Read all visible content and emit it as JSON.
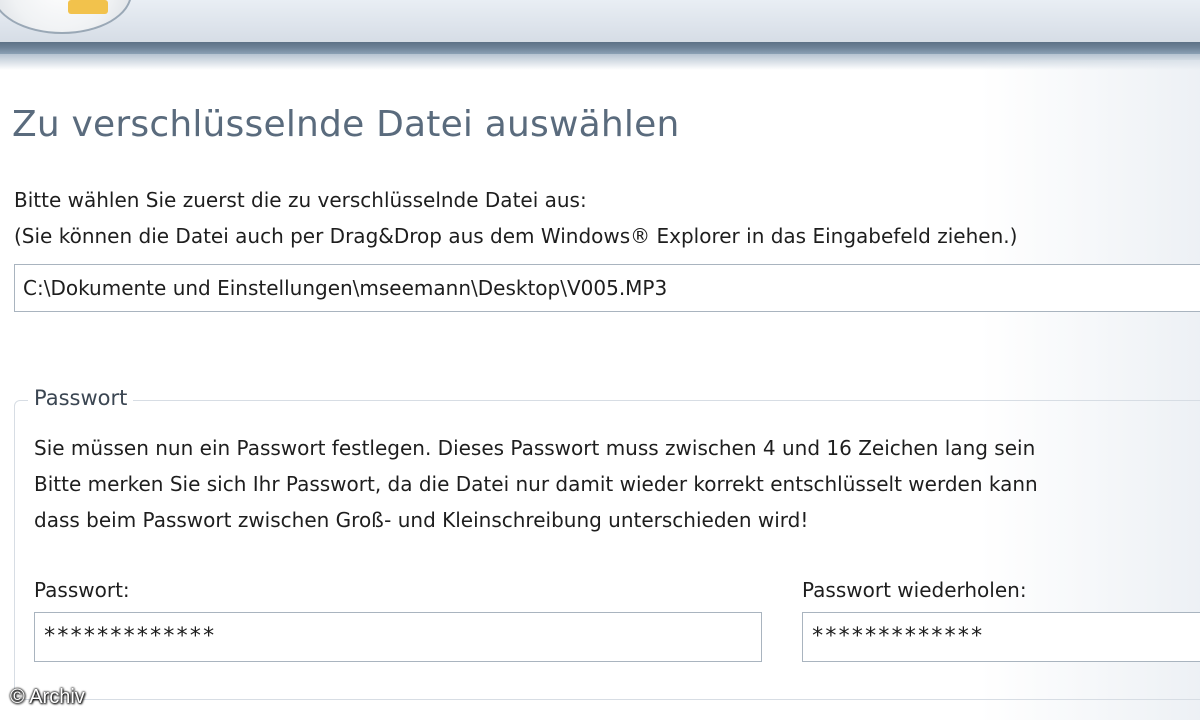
{
  "header": {
    "logo_icon": "app-logo-icon"
  },
  "page": {
    "title": "Zu verschlüsselnde Datei auswählen",
    "instruction_line1": "Bitte wählen Sie zuerst die zu verschlüsselnde Datei aus:",
    "instruction_line2": "(Sie können die Datei auch per Drag&Drop aus dem Windows® Explorer in das Eingabefeld ziehen.)",
    "file_path_value": "C:\\Dokumente und Einstellungen\\mseemann\\Desktop\\V005.MP3"
  },
  "password_group": {
    "legend": "Passwort",
    "text_line1": "Sie müssen nun ein Passwort festlegen. Dieses Passwort muss zwischen 4 und 16 Zeichen lang sein",
    "text_line2": "Bitte merken Sie sich Ihr Passwort, da die Datei nur damit wieder korrekt entschlüsselt werden kann",
    "text_line3": "dass beim Passwort zwischen Groß- und Kleinschreibung unterschieden wird!",
    "password_label": "Passwort:",
    "password_value": "*************",
    "repeat_label": "Passwort wiederholen:",
    "repeat_value": "*************"
  },
  "watermark": "© Archiv"
}
